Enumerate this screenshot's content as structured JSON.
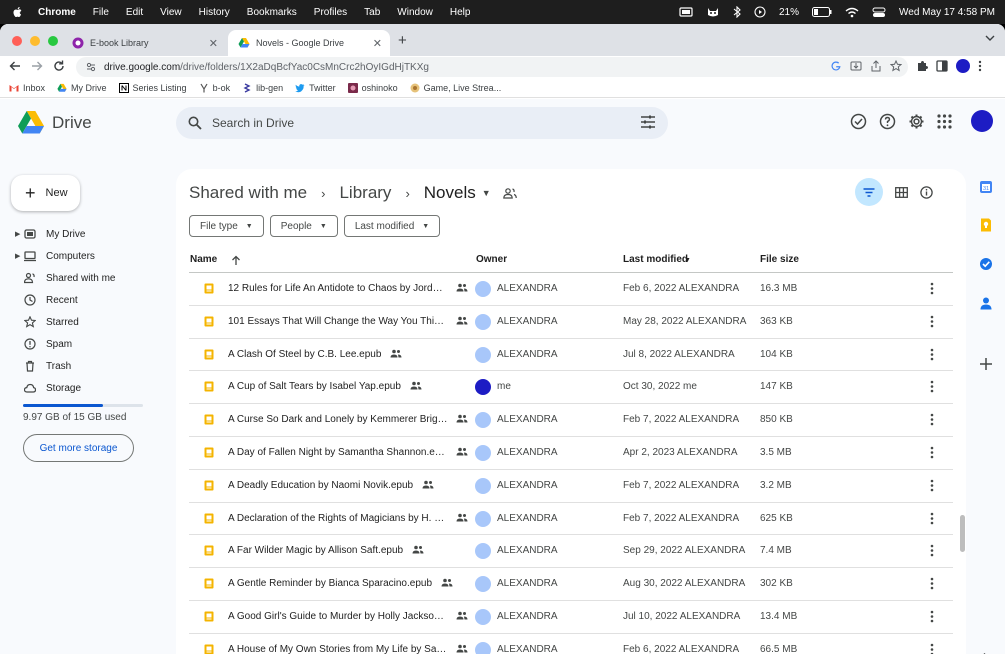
{
  "menubar": {
    "items": [
      "Chrome",
      "File",
      "Edit",
      "View",
      "History",
      "Bookmarks",
      "Profiles",
      "Tab",
      "Window",
      "Help"
    ],
    "battery": "21%",
    "datetime": "Wed May 17  4:58 PM"
  },
  "tabs": [
    {
      "title": "E-book Library"
    },
    {
      "title": "Novels - Google Drive"
    }
  ],
  "omnibox": {
    "host": "drive.google.com",
    "path": "/drive/folders/1X2aDqBcfYac0CsMnCrc2hOyIGdHjTKXg"
  },
  "bookmarks": [
    "Inbox",
    "My Drive",
    "Series Listing",
    "b-ok",
    "lib-gen",
    "Twitter",
    "oshinoko",
    "Game, Live Strea..."
  ],
  "drive": {
    "logo_text": "Drive",
    "search_placeholder": "Search in Drive",
    "new_label": "New",
    "nav": [
      {
        "label": "My Drive",
        "caret": true,
        "icon": "drive-icon"
      },
      {
        "label": "Computers",
        "caret": true,
        "icon": "computer-icon"
      },
      {
        "label": "Shared with me",
        "caret": false,
        "icon": "people-icon"
      },
      {
        "label": "Recent",
        "caret": false,
        "icon": "clock-icon"
      },
      {
        "label": "Starred",
        "caret": false,
        "icon": "star-icon"
      },
      {
        "label": "Spam",
        "caret": false,
        "icon": "spam-icon"
      },
      {
        "label": "Trash",
        "caret": false,
        "icon": "trash-icon"
      },
      {
        "label": "Storage",
        "caret": false,
        "icon": "cloud-icon"
      }
    ],
    "storage": {
      "used_text": "9.97 GB of 15 GB used",
      "fraction": 0.665,
      "button": "Get more storage"
    },
    "breadcrumb": [
      "Shared with me",
      "Library",
      "Novels"
    ],
    "filters": [
      "File type",
      "People",
      "Last modified"
    ],
    "columns": {
      "name": "Name",
      "owner": "Owner",
      "modified": "Last modified",
      "size": "File size"
    },
    "files": [
      {
        "name": "12 Rules for Life An Antidote to Chaos by Jordan ...",
        "owner": "ALEXANDRA",
        "modified": "Feb 6, 2022  ALEXANDRA",
        "size": "16.3 MB",
        "me": false
      },
      {
        "name": "101 Essays That Will Change the Way You Think b...",
        "owner": "ALEXANDRA",
        "modified": "May 28, 2022  ALEXANDRA",
        "size": "363 KB",
        "me": false
      },
      {
        "name": "A Clash Of Steel by C.B. Lee.epub",
        "owner": "ALEXANDRA",
        "modified": "Jul 8, 2022  ALEXANDRA",
        "size": "104 KB",
        "me": false
      },
      {
        "name": "A Cup of Salt Tears by Isabel Yap.epub",
        "owner": "me",
        "modified": "Oct 30, 2022  me",
        "size": "147 KB",
        "me": true
      },
      {
        "name": "A Curse So Dark and Lonely by Kemmerer Brigid...",
        "owner": "ALEXANDRA",
        "modified": "Feb 7, 2022  ALEXANDRA",
        "size": "850 KB",
        "me": false
      },
      {
        "name": "A Day of Fallen Night by Samantha Shannon.epub",
        "owner": "ALEXANDRA",
        "modified": "Apr 2, 2023  ALEXANDRA",
        "size": "3.5 MB",
        "me": false
      },
      {
        "name": "A Deadly Education by Naomi Novik.epub",
        "owner": "ALEXANDRA",
        "modified": "Feb 7, 2022  ALEXANDRA",
        "size": "3.2 MB",
        "me": false
      },
      {
        "name": "A Declaration of the Rights of Magicians by H. G....",
        "owner": "ALEXANDRA",
        "modified": "Feb 7, 2022  ALEXANDRA",
        "size": "625 KB",
        "me": false
      },
      {
        "name": "A Far Wilder Magic by Allison Saft.epub",
        "owner": "ALEXANDRA",
        "modified": "Sep 29, 2022  ALEXANDRA",
        "size": "7.4 MB",
        "me": false
      },
      {
        "name": "A Gentle Reminder by Bianca Sparacino.epub",
        "owner": "ALEXANDRA",
        "modified": "Aug 30, 2022  ALEXANDRA",
        "size": "302 KB",
        "me": false
      },
      {
        "name": "A Good Girl's Guide to Murder by Holly Jackson....",
        "owner": "ALEXANDRA",
        "modified": "Jul 10, 2022  ALEXANDRA",
        "size": "13.4 MB",
        "me": false
      },
      {
        "name": "A House of My Own Stories from My Life by San...",
        "owner": "ALEXANDRA",
        "modified": "Feb 6, 2022  ALEXANDRA",
        "size": "66.5 MB",
        "me": false
      }
    ]
  },
  "colors": {
    "accent": "#0b57d0",
    "profile": "#1d1cc4",
    "filter_active": "#c2e7ff"
  }
}
